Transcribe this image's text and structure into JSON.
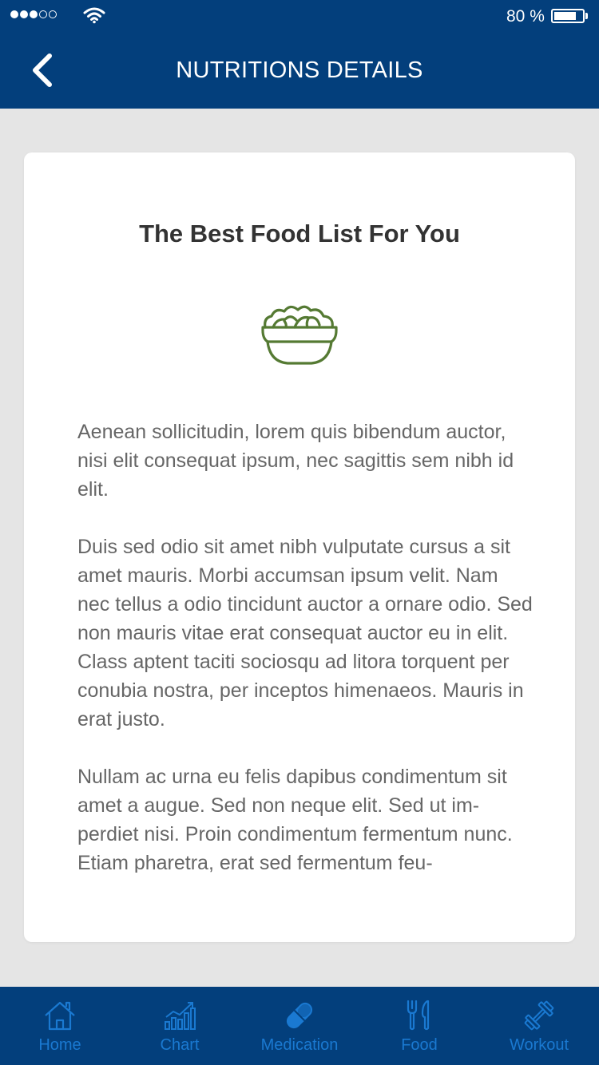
{
  "status_bar": {
    "battery_percent": "80 %",
    "battery_level": 0.8,
    "signal_strength": 3,
    "signal_max": 5
  },
  "header": {
    "title": "NUTRITIONS DETAILS",
    "back_icon": "chevron-left-icon"
  },
  "card": {
    "title": "The Best Food List For You",
    "icon": "salad-bowl-icon",
    "paragraphs": [
      "Aenean sollicitudin, lorem quis bibendum auctor, nisi elit consequat ipsum, nec sagittis sem nibh id elit.",
      "Duis sed odio sit amet nibh vulputate cursus a sit amet mauris. Morbi accumsan ipsum velit. Nam nec tellus a odio tincidunt auctor a ornare odio. Sed non  mauris vitae erat consequat auctor eu in elit. Class aptent taciti sociosqu ad litora torquent per conubia nostra, per inceptos himenaeos. Mauris in erat justo.",
      "Nullam ac urna eu felis dapibus condimentum sit amet a augue. Sed non neque elit. Sed ut im-perdiet nisi. Proin condimentum fermentum nunc. Etiam pharetra, erat sed fermentum feu-"
    ]
  },
  "tabs": [
    {
      "label": "Home",
      "icon": "home-icon"
    },
    {
      "label": "Chart",
      "icon": "bar-chart-icon"
    },
    {
      "label": "Medication",
      "icon": "pill-icon"
    },
    {
      "label": "Food",
      "icon": "fork-knife-icon"
    },
    {
      "label": "Workout",
      "icon": "dumbbell-icon"
    }
  ],
  "colors": {
    "primary": "#033f7c",
    "tab_accent": "#1a79d1",
    "icon_green": "#557a33",
    "background": "#e5e5e5"
  }
}
